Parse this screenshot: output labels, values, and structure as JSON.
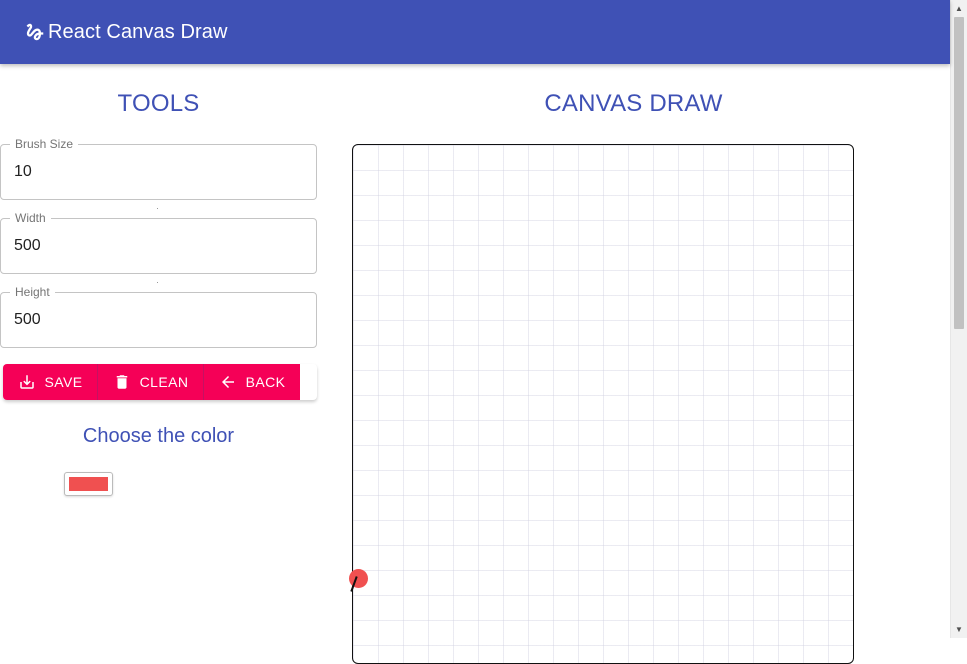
{
  "appbar": {
    "title": "React Canvas Draw",
    "icon": "gesture-icon",
    "color": "#3f51b5"
  },
  "tools": {
    "title": "TOOLS",
    "fields": [
      {
        "label": "Brush Size",
        "value": "10"
      },
      {
        "label": "Width",
        "value": "500"
      },
      {
        "label": "Height",
        "value": "500"
      }
    ],
    "buttons": {
      "save": {
        "label": "SAVE",
        "icon": "download-icon"
      },
      "clean": {
        "label": "CLEAN",
        "icon": "trash-icon"
      },
      "back": {
        "label": "BACK",
        "icon": "arrow-left-icon"
      },
      "color": "#f50057"
    },
    "color_title": "Choose the color",
    "selected_color": "#f05050"
  },
  "canvas": {
    "title": "CANVAS DRAW",
    "brush_color": "#f05050"
  }
}
